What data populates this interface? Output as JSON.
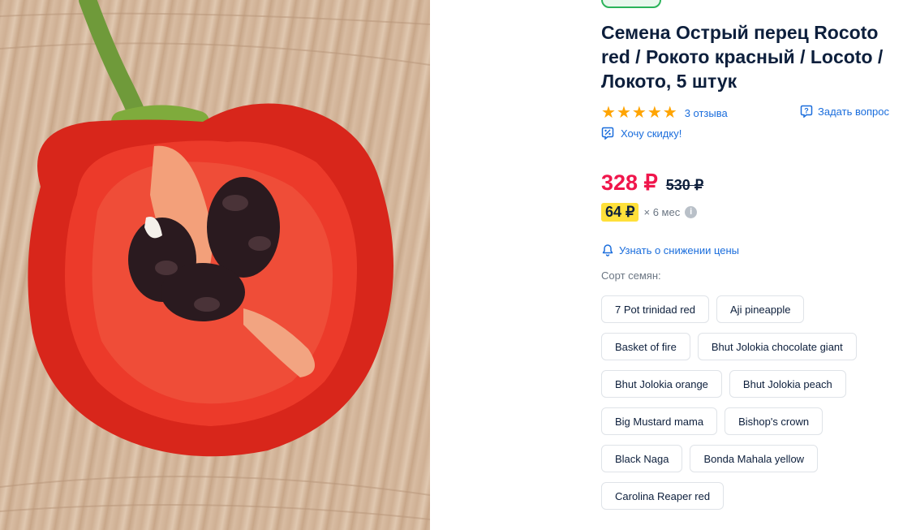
{
  "product": {
    "title": "Семена Острый перец Rocoto red / Рокото красный / Locoto / Локото, 5 штук",
    "rating_stars": 5,
    "reviews_label": "3 отзыва",
    "ask_question_label": "Задать вопрос",
    "discount_label": "Хочу скидку!"
  },
  "price": {
    "current": "328 ₽",
    "old": "530 ₽",
    "installment_amount": "64 ₽",
    "installment_term": "× 6 мес",
    "price_drop_label": "Узнать о снижении цены"
  },
  "variants": {
    "label": "Сорт семян:",
    "rows": [
      [
        "7 Pot trinidad red",
        "Aji pineapple"
      ],
      [
        "Basket of fire",
        "Bhut Jolokia chocolate giant"
      ],
      [
        "Bhut Jolokia orange",
        "Bhut Jolokia peach"
      ],
      [
        "Big Mustard mama",
        "Bishop's crown"
      ],
      [
        "Black Naga",
        "Bonda Mahala yellow"
      ],
      [
        "Carolina Reaper red"
      ]
    ]
  },
  "colors": {
    "accent_link": "#1a6ddc",
    "price": "#f0164c",
    "star": "#ffa400",
    "installment_bg": "#ffe03a",
    "badge_green": "#2bb35a"
  },
  "icons": {
    "star": "star-icon",
    "ask": "question-bubble-icon",
    "discount": "discount-tag-icon",
    "bell": "bell-icon",
    "info": "info-icon"
  }
}
